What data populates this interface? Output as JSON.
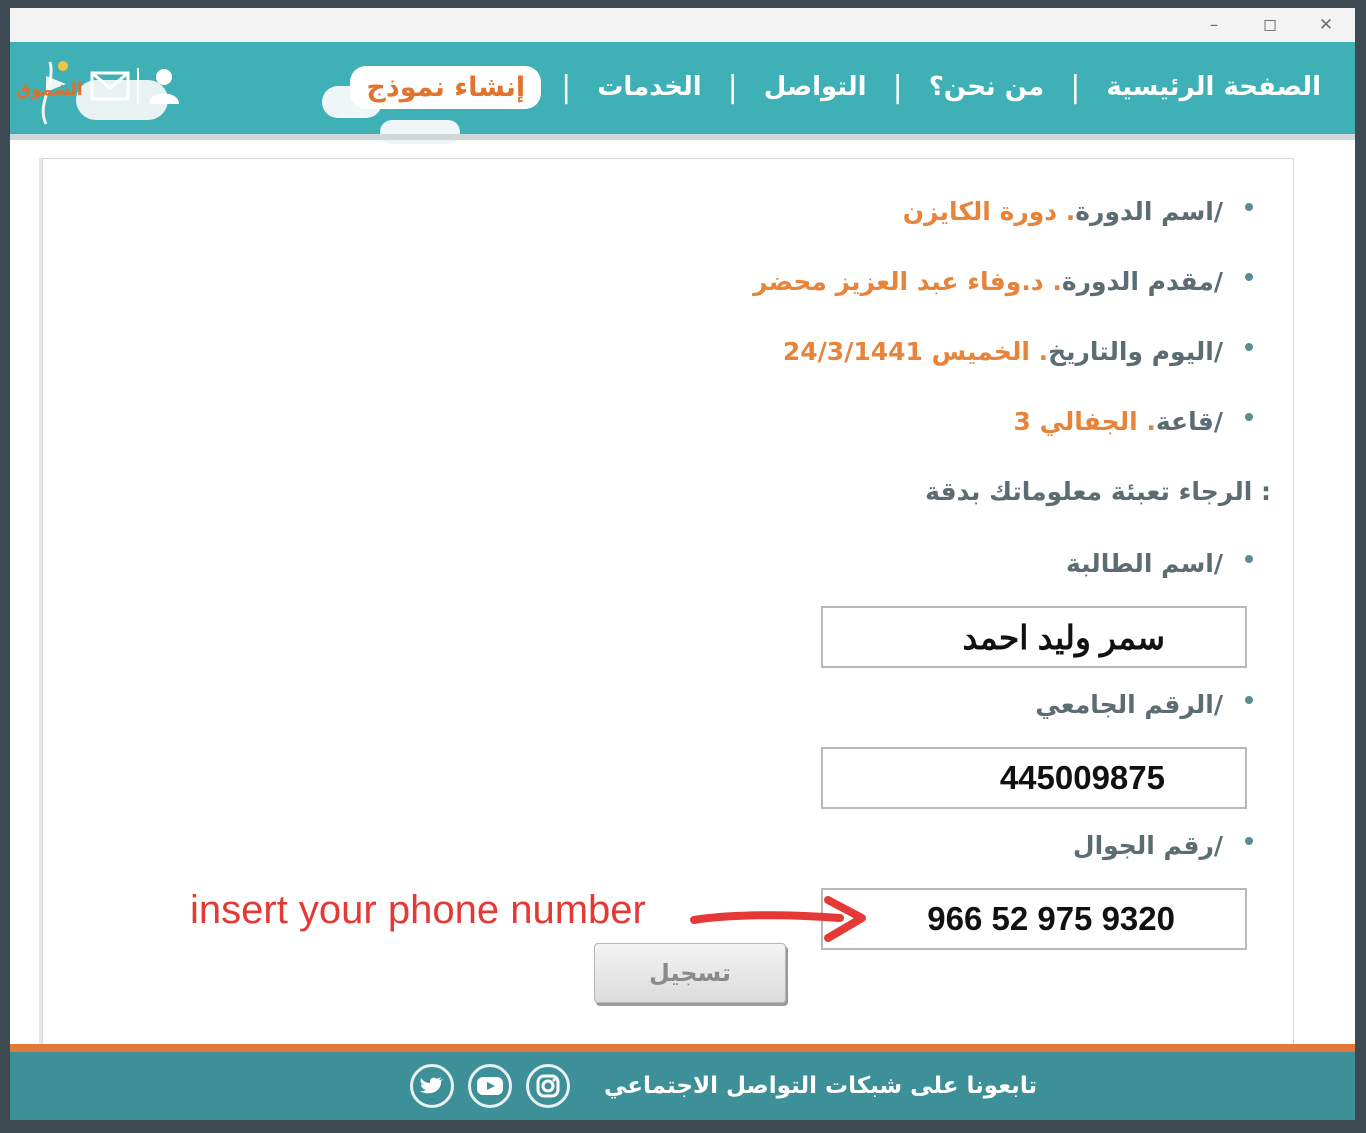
{
  "window": {
    "controls": {
      "minimize": "–",
      "maximize": "◻",
      "close": "✕"
    }
  },
  "logo": {
    "text": "الشموق"
  },
  "nav": {
    "items": [
      "الصفحة الرئيسية",
      "من نحن؟",
      "التواصل",
      "الخدمات"
    ],
    "active": "إنشاء نموذج",
    "separator": "|"
  },
  "course": {
    "rows": [
      {
        "label": "اسم الدورة/",
        "value": " دورة الكايزن ."
      },
      {
        "label": "مقدم الدورة/",
        "value": "د.وفاء عبد العزيز محضر ."
      },
      {
        "label": "اليوم والتاريخ/",
        "value": " الخميس 24/3/1441 ."
      },
      {
        "label": "قاعة/",
        "value": " الجفالي 3 ."
      }
    ]
  },
  "form": {
    "intro": "الرجاء تعبئة معلوماتك بدقة :",
    "name_label": "اسم الطالبة/",
    "name_value": "سمر وليد احمد",
    "id_label": "الرقم الجامعي/",
    "id_value": "445009875",
    "phone_label": "رقم الجوال/",
    "phone_value": "966 52 975 9320",
    "submit_label": "تسجيل"
  },
  "annotation": {
    "text": "insert your phone number",
    "color": "#e53935"
  },
  "footer": {
    "text": "تابعونا على شبكات التواصل الاجتماعي",
    "icons": [
      "twitter-icon",
      "youtube-icon",
      "instagram-icon"
    ]
  },
  "colors": {
    "teal": "#3fb1b6",
    "orange": "#e8843a",
    "footer": "#3d8f98",
    "footer_line": "#e07a3b"
  }
}
